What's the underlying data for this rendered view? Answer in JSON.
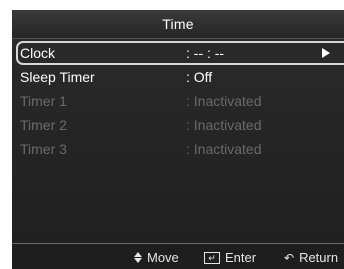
{
  "title": "Time",
  "menu": {
    "items": [
      {
        "label": "Clock",
        "value": ": -- : --",
        "state": "selected"
      },
      {
        "label": "Sleep Timer",
        "value": ": Off",
        "state": "normal"
      },
      {
        "label": "Timer 1",
        "value": ": Inactivated",
        "state": "disabled"
      },
      {
        "label": "Timer 2",
        "value": ": Inactivated",
        "state": "disabled"
      },
      {
        "label": "Timer 3",
        "value": ": Inactivated",
        "state": "disabled"
      }
    ]
  },
  "footer": {
    "move_label": "Move",
    "enter_label": "Enter",
    "return_label": "Return"
  },
  "icons": {
    "selected_arrow": "right-triangle-icon",
    "move": "up-down-arrows-icon",
    "enter": "enter-key-icon",
    "return": "return-arrow-icon"
  },
  "colors": {
    "background": "#232323",
    "text": "#ffffff",
    "disabled_text": "#6a6a6a",
    "selection_border": "#d8d8d8"
  }
}
